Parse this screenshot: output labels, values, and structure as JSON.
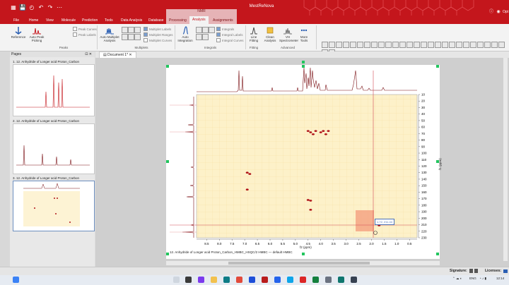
{
  "app": {
    "title": "MestReNova",
    "quick_access": [
      "▦",
      "💾",
      "◴",
      "↶",
      "↷",
      "⋯"
    ],
    "window_controls": [
      "—",
      "❐",
      "✕"
    ]
  },
  "tabs": {
    "context_group": "NMR",
    "items": [
      "File",
      "Home",
      "View",
      "Molecule",
      "Prediction",
      "Tools",
      "Data Analysis",
      "Database",
      "Processing",
      "Analysis",
      "Assignments"
    ],
    "active": "Analysis"
  },
  "ribbon": {
    "reference": "Reference",
    "auto_peak_picking": "Auto Peak Picking",
    "peak_curves": "Peak Curves",
    "peak_labels": "Peak Labels",
    "peaks_group": "Peaks",
    "auto_multiplet_analysis": "Auto Multiplet Analysis",
    "multiplet_labels": "Multiplet Labels",
    "multiplet_ranges": "Multiplet Ranges",
    "multiplet_curves": "Multiplet Curves",
    "multiplets_group": "Multiplets",
    "auto_integration": "Auto Integration",
    "integrals": "Integrals",
    "integral_labels": "Integral Labels",
    "integral_curves": "Integral Curves",
    "integrals_group": "Integrals",
    "line_fitting": "Line Fitting",
    "fitting_group": "Fitting",
    "clean_analysis": "Clean Analysis",
    "vh_spectrometer": "VH Spectrometer",
    "advanced_group": "Advanced",
    "more_tools": "More Tools"
  },
  "pages_panel": {
    "title": "Pages",
    "items": [
      {
        "label": "1. 12. Anhydride of Longer acid Proton_Carbon"
      },
      {
        "label": "2. 12. Anhydride of Longer acid Proton_Carbon"
      },
      {
        "label": "3. 12. Anhydride of Longer acid Proton_Carbon"
      }
    ]
  },
  "document": {
    "tab_label": "Document 1*",
    "caption": "12. Anhydride of Longer acid Proton_Carbon_HMBC_HSQC/2 HMBC — default HMBC",
    "x_axis_title": "f2 (ppm)",
    "y_axis_title": "f1 (ppm)",
    "cursor_readout": "1.72, 211.44"
  },
  "chart_data": {
    "type": "heatmap",
    "x_ticks": [
      "8.5",
      "8.0",
      "7.5",
      "7.0",
      "6.5",
      "6.0",
      "5.5",
      "5.0",
      "4.5",
      "4.0",
      "3.5",
      "3.0",
      "2.5",
      "2.0",
      "1.5",
      "1.0",
      "0.5"
    ],
    "y_ticks": [
      "10",
      "20",
      "30",
      "40",
      "50",
      "60",
      "70",
      "80",
      "90",
      "100",
      "110",
      "120",
      "130",
      "140",
      "150",
      "160",
      "170",
      "180",
      "190",
      "200",
      "210",
      "220",
      "230"
    ],
    "xlim": [
      8.9,
      0.2
    ],
    "ylim": [
      10,
      230
    ],
    "x_reversed": true,
    "peaks": [
      {
        "x": 4.5,
        "y": 66
      },
      {
        "x": 4.4,
        "y": 68
      },
      {
        "x": 4.3,
        "y": 71
      },
      {
        "x": 4.2,
        "y": 66
      },
      {
        "x": 4.0,
        "y": 68
      },
      {
        "x": 3.9,
        "y": 66
      },
      {
        "x": 3.8,
        "y": 71
      },
      {
        "x": 3.7,
        "y": 66
      },
      {
        "x": 6.9,
        "y": 130
      },
      {
        "x": 6.8,
        "y": 132
      },
      {
        "x": 6.9,
        "y": 156
      },
      {
        "x": 4.5,
        "y": 172
      },
      {
        "x": 4.4,
        "y": 173
      },
      {
        "x": 4.4,
        "y": 187
      },
      {
        "x": 1.7,
        "y": 211
      }
    ],
    "colors": {
      "background": "#fdf1c9",
      "peak": "#b0141a",
      "trace": "#7a1014",
      "cursor": "#d24a55"
    }
  },
  "status": {
    "signature_label": "Signature:",
    "licenses_label": "Licenses:"
  },
  "taskbar": {
    "tray_language": "ENG",
    "tray_time": "12:14"
  }
}
